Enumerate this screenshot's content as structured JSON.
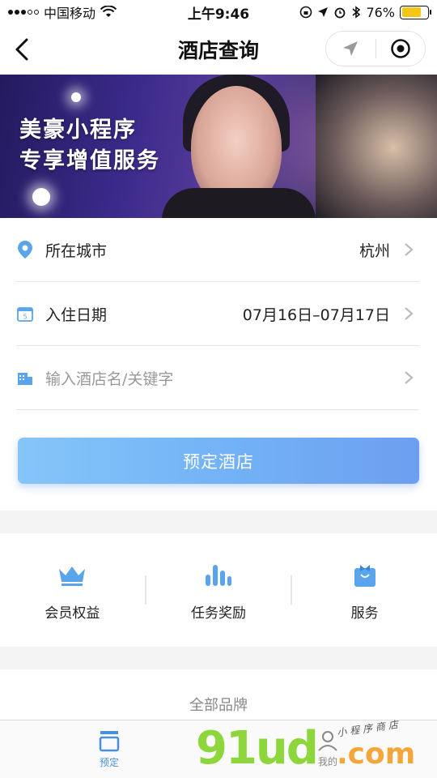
{
  "status_bar": {
    "carrier": "中国移动",
    "time": "上午9:46",
    "battery_percent": "76%",
    "battery_level": 0.76,
    "icons": [
      "signal-dots-icon",
      "wifi-icon",
      "lock-rotation-icon",
      "location-arrow-icon",
      "alarm-icon",
      "bluetooth-icon",
      "battery-icon"
    ]
  },
  "nav": {
    "title": "酒店查询",
    "back_icon": "chevron-left-icon",
    "capsule_icons": [
      "location-arrow-icon",
      "target-circle-icon"
    ]
  },
  "banner": {
    "slogan_line1": "美豪小程序",
    "slogan_line2": "专享增值服务"
  },
  "form": {
    "city": {
      "label": "所在城市",
      "value": "杭州",
      "icon": "location-pin-icon"
    },
    "date": {
      "label": "入住日期",
      "value": "07月16日–07月17日",
      "icon": "calendar-icon"
    },
    "keyword": {
      "placeholder": "输入酒店名/关键字",
      "icon": "building-icon"
    }
  },
  "book_button": {
    "label": "预定酒店"
  },
  "quick_links": [
    {
      "label": "会员权益",
      "icon": "crown-icon"
    },
    {
      "label": "任务奖励",
      "icon": "bar-chart-icon"
    },
    {
      "label": "服务",
      "icon": "service-bowtie-icon"
    }
  ],
  "brands": {
    "title": "全部品牌"
  },
  "tabbar": {
    "tabs": [
      {
        "label": "预定",
        "icon": "booking-tab-icon",
        "active": true
      },
      {
        "label": "我的",
        "icon": "profile-tab-icon",
        "active": false
      }
    ]
  },
  "watermark": {
    "main": "91ud",
    "suffix": ".com",
    "sub": "小程序商店"
  },
  "colors": {
    "accent": "#4a90e2",
    "button_gradient_start": "#85c5f9",
    "button_gradient_end": "#6d9ff0",
    "icon_blue": "#5aa4ec",
    "watermark_green": "#8dd63c",
    "watermark_orange": "#f4a63a"
  }
}
